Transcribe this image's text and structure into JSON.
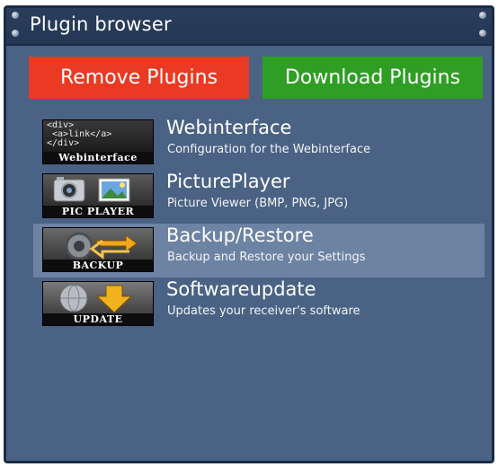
{
  "window": {
    "title": "Plugin browser"
  },
  "buttons": {
    "remove_label": "Remove Plugins",
    "download_label": "Download Plugins"
  },
  "colors": {
    "remove": "#ea3a24",
    "download": "#2f9e24",
    "panel": "#4a6283",
    "selection": "#6c83a3"
  },
  "plugins": [
    {
      "name": "Webinterface",
      "description": "Configuration for the Webinterface",
      "icon": "webinterface-icon",
      "icon_caption": "Webinterface",
      "icon_code": "<div>\n <a>link</a>\n</div>"
    },
    {
      "name": "PicturePlayer",
      "description": "Picture Viewer (BMP, PNG, JPG)",
      "icon": "picture-player-icon",
      "icon_caption": "PIC PLAYER"
    },
    {
      "name": "Backup/Restore",
      "description": "Backup and Restore your Settings",
      "icon": "backup-icon",
      "icon_caption": "BACKUP",
      "selected": true
    },
    {
      "name": "Softwareupdate",
      "description": "Updates your receiver's software",
      "icon": "update-icon",
      "icon_caption": "UPDATE"
    }
  ]
}
